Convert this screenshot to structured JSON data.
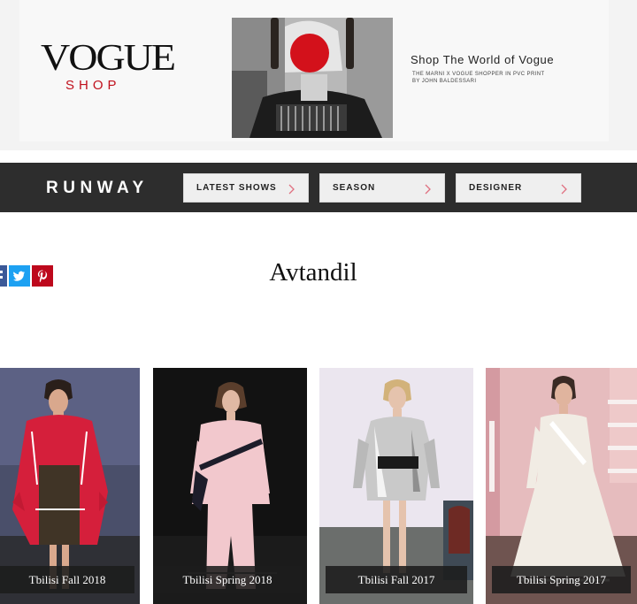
{
  "ad": {
    "logo": "VOGUE",
    "shop": "SHOP",
    "title": "Shop The World of Vogue",
    "subtitle_line1": "THE MARNI X VOGUE SHOPPER IN PVC PRINT",
    "subtitle_line2": "BY JOHN BALDESSARI"
  },
  "nav": {
    "title": "RUNWAY",
    "buttons": [
      {
        "label": "LATEST SHOWS"
      },
      {
        "label": "SEASON"
      },
      {
        "label": "DESIGNER"
      }
    ]
  },
  "social": [
    "facebook-icon",
    "twitter-icon",
    "pinterest-icon"
  ],
  "page": {
    "title": "Avtandil"
  },
  "shows": [
    {
      "caption": "Tbilisi Fall 2018"
    },
    {
      "caption": "Tbilisi Spring 2018"
    },
    {
      "caption": "Tbilisi Fall 2017"
    },
    {
      "caption": "Tbilisi Spring 2017"
    }
  ],
  "colors": {
    "brand_red": "#c0101c",
    "nav_bg": "#2d2d2d",
    "facebook": "#3b5998",
    "twitter": "#1da1f2",
    "pinterest": "#bd081c"
  }
}
